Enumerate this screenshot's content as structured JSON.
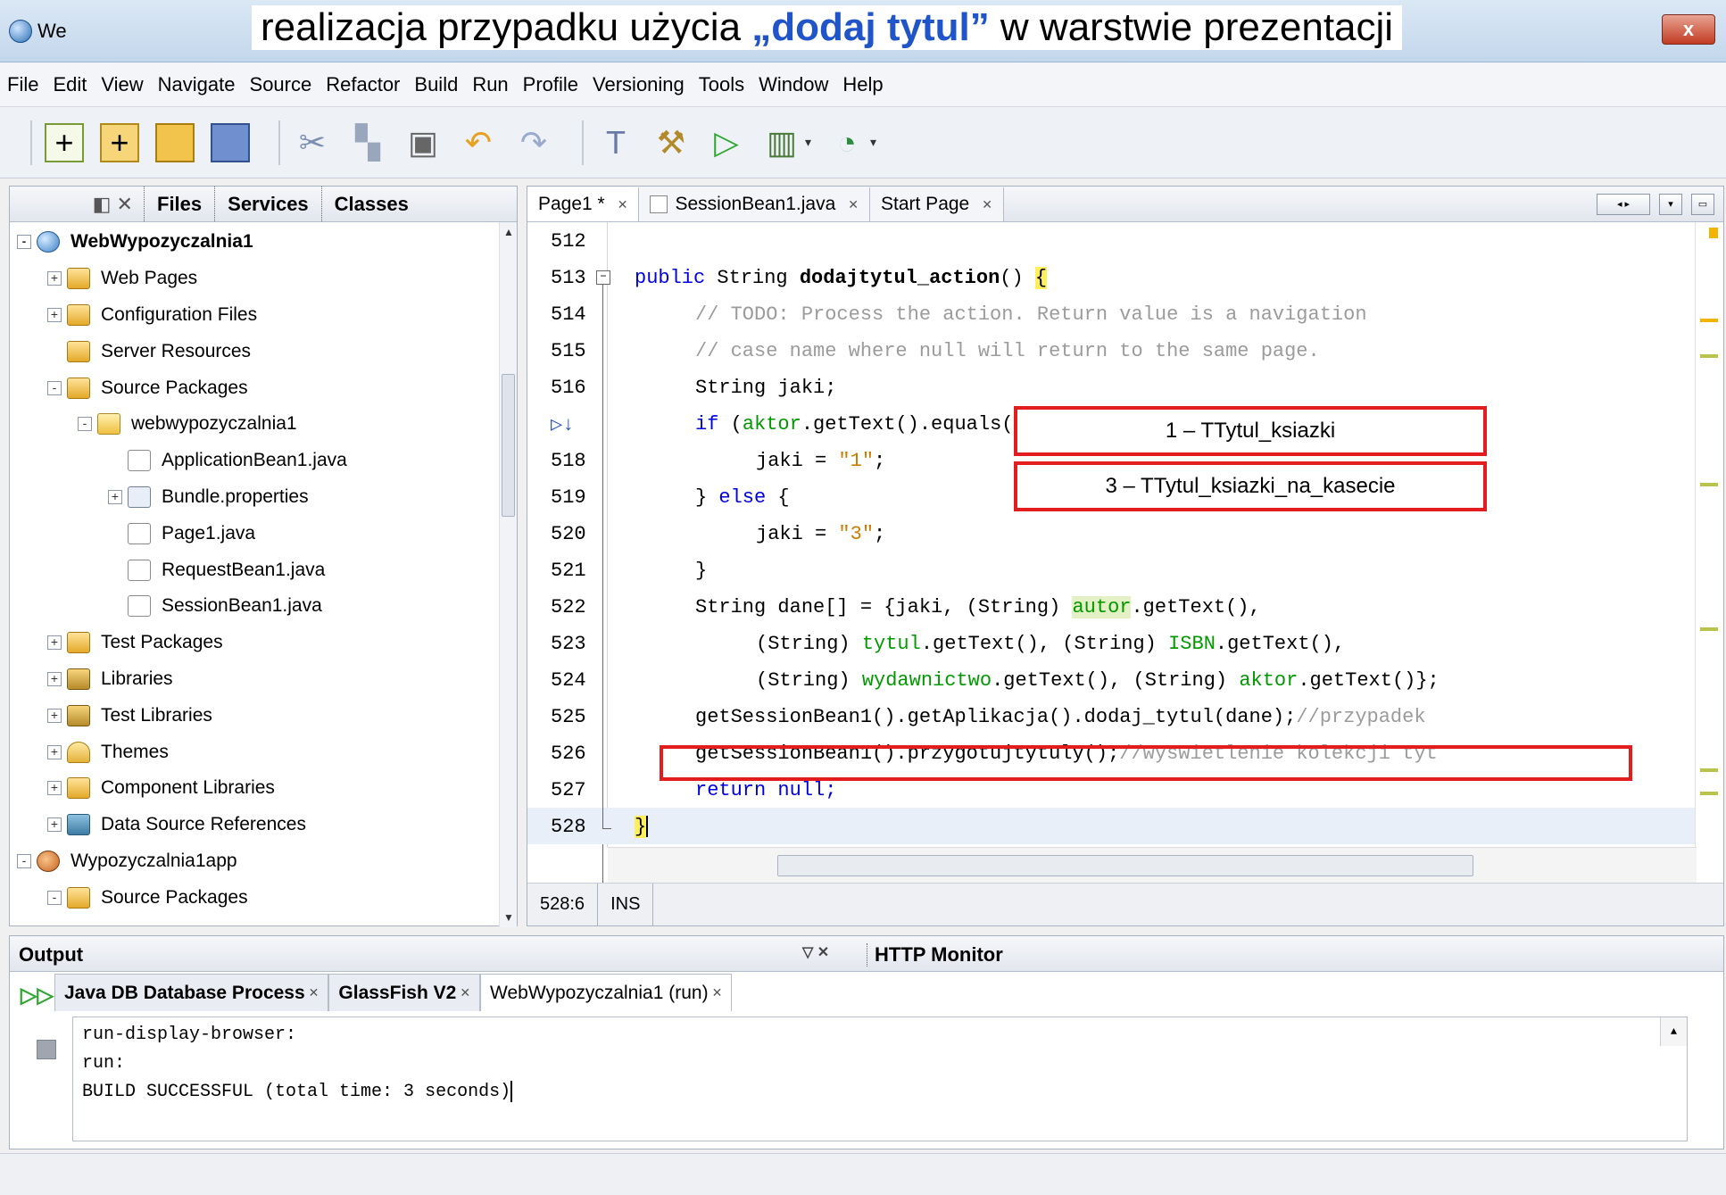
{
  "window": {
    "app_name": "We",
    "slide_title_pre": "realizacja przypadku użycia ",
    "slide_title_highlight": "„dodaj tytul”",
    "slide_title_post": " w warstwie prezentacji",
    "close_label": "x"
  },
  "menu": [
    "File",
    "Edit",
    "View",
    "Navigate",
    "Source",
    "Refactor",
    "Build",
    "Run",
    "Profile",
    "Versioning",
    "Tools",
    "Window",
    "Help"
  ],
  "left_panel": {
    "tabs": [
      "Files",
      "Services",
      "Classes"
    ],
    "tree": [
      {
        "label": "WebWypozyczalnia1",
        "level": 0,
        "expander": "-",
        "icon": "globe",
        "bold": true
      },
      {
        "label": "Web Pages",
        "level": 1,
        "expander": "+",
        "icon": "folder"
      },
      {
        "label": "Configuration Files",
        "level": 1,
        "expander": "+",
        "icon": "folder"
      },
      {
        "label": "Server Resources",
        "level": 1,
        "expander": "",
        "icon": "folder"
      },
      {
        "label": "Source Packages",
        "level": 1,
        "expander": "-",
        "icon": "folder"
      },
      {
        "label": "webwypozyczalnia1",
        "level": 2,
        "expander": "-",
        "icon": "pkg"
      },
      {
        "label": "ApplicationBean1.java",
        "level": 3,
        "expander": "",
        "icon": "java"
      },
      {
        "label": "Bundle.properties",
        "level": 3,
        "expander": "+",
        "icon": "props"
      },
      {
        "label": "Page1.java",
        "level": 3,
        "expander": "",
        "icon": "java"
      },
      {
        "label": "RequestBean1.java",
        "level": 3,
        "expander": "",
        "icon": "java"
      },
      {
        "label": "SessionBean1.java",
        "level": 3,
        "expander": "",
        "icon": "java"
      },
      {
        "label": "Test Packages",
        "level": 1,
        "expander": "+",
        "icon": "folder"
      },
      {
        "label": "Libraries",
        "level": 1,
        "expander": "+",
        "icon": "lib"
      },
      {
        "label": "Test Libraries",
        "level": 1,
        "expander": "+",
        "icon": "lib"
      },
      {
        "label": "Themes",
        "level": 1,
        "expander": "+",
        "icon": "themes"
      },
      {
        "label": "Component Libraries",
        "level": 1,
        "expander": "+",
        "icon": "folder"
      },
      {
        "label": "Data Source References",
        "level": 1,
        "expander": "+",
        "icon": "db"
      },
      {
        "label": "Wypozyczalnia1app",
        "level": 0,
        "expander": "-",
        "icon": "cup"
      },
      {
        "label": "Source Packages",
        "level": 1,
        "expander": "-",
        "icon": "folder"
      }
    ]
  },
  "editor": {
    "tabs": [
      {
        "label": "Page1 *",
        "active": true
      },
      {
        "label": "SessionBean1.java",
        "active": false
      },
      {
        "label": "Start Page",
        "active": false
      }
    ],
    "line_numbers": [
      "512",
      "513",
      "514",
      "515",
      "516",
      "",
      "518",
      "519",
      "520",
      "521",
      "522",
      "523",
      "524",
      "525",
      "526",
      "527",
      "528"
    ],
    "lines": {
      "l513_kw": "public",
      "l513_type": " String ",
      "l513_name": "dodajtytul_action",
      "l513_rest": "() ",
      "l513_brace": "{",
      "l514": "// TODO: Process the action. Return value is a navigation",
      "l515": "// case name where null will return to the same page.",
      "l516": "String jaki;",
      "l517_kw": "if",
      "l517_a": " (",
      "l517_f": "aktor",
      "l517_b": ".getText().equals(",
      "l517_s": "\"\"",
      "l517_c": ")) {",
      "l518_a": "jaki = ",
      "l518_s": "\"1\"",
      "l518_b": ";",
      "l519_a": "} ",
      "l519_kw": "else",
      "l519_b": " {",
      "l520_a": "jaki = ",
      "l520_s": "\"3\"",
      "l520_b": ";",
      "l521": "}",
      "l522_a": "String dane[] = {jaki, (String) ",
      "l522_f": "autor",
      "l522_b": ".getText(),",
      "l523_a": "(String) ",
      "l523_f1": "tytul",
      "l523_b": ".getText(), (String) ",
      "l523_f2": "ISBN",
      "l523_c": ".getText(),",
      "l524_a": "(String) ",
      "l524_f1": "wydawnictwo",
      "l524_b": ".getText(), (String) ",
      "l524_f2": "aktor",
      "l524_c": ".getText()};",
      "l525_a": "getSessionBean1().getAplikacja().dodaj_tytul(dane);",
      "l525_cm": "//przypadek",
      "l526_a": "getSessionBean1().przygotujtytuly();",
      "l526_cm": "//wyswietlenie kolekcji tyt",
      "l527_kw": "return",
      "l527_b": " null;",
      "l528": "}"
    },
    "annotations": [
      "1 – TTytul_ksiazki",
      "3 – TTytul_ksiazki_na_kasecie"
    ],
    "status": {
      "position": "528:6",
      "mode": "INS"
    }
  },
  "output": {
    "title": "Output",
    "http_monitor": "HTTP Monitor",
    "tabs": [
      {
        "label": "Java DB Database Process",
        "active": false
      },
      {
        "label": "GlassFish V2",
        "active": false
      },
      {
        "label": "WebWypozyczalnia1 (run)",
        "active": true
      }
    ],
    "console": [
      "run-display-browser:",
      "run:",
      "BUILD SUCCESSFUL (total time: 3 seconds)"
    ]
  },
  "colors": {
    "annotation_border": "#e31d1d",
    "title_highlight": "#1f55c8",
    "keyword": "#0000e6",
    "field": "#009900",
    "string": "#ce7b00",
    "comment": "#9b9b9b"
  }
}
